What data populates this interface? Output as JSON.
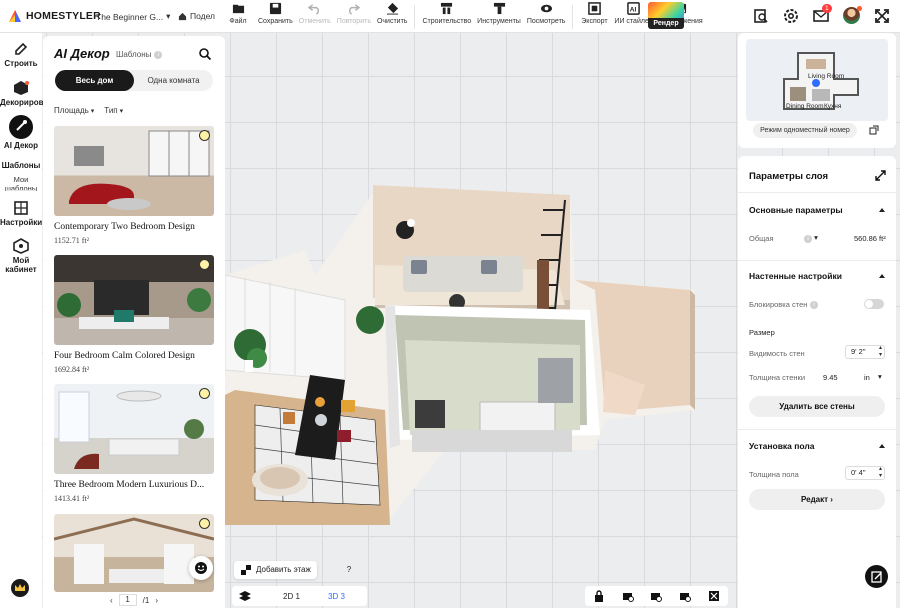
{
  "app": {
    "name": "HOMESTYLER",
    "project": "The Beginner G...",
    "house_crumb": "Подел"
  },
  "toolbar": {
    "items": [
      {
        "label": "Файл",
        "icon": "folder-icon",
        "enabled": true
      },
      {
        "label": "Сохранить",
        "icon": "save-icon",
        "enabled": true
      },
      {
        "label": "Отменить",
        "icon": "undo-icon",
        "enabled": false
      },
      {
        "label": "Повторить",
        "icon": "redo-icon",
        "enabled": false
      },
      {
        "label": "Очистить",
        "icon": "eraser-icon",
        "enabled": true
      },
      {
        "label": "Строительство",
        "icon": "build-icon",
        "enabled": true
      },
      {
        "label": "Инструменты",
        "icon": "tools-icon",
        "enabled": true
      },
      {
        "label": "Посмотреть",
        "icon": "eye-icon",
        "enabled": true
      },
      {
        "label": "Экспорт",
        "icon": "export-icon",
        "enabled": true
      },
      {
        "label": "ИИ стайлер",
        "icon": "ai-styler-icon",
        "enabled": true
      },
      {
        "label": "Изображения",
        "icon": "image-icon",
        "enabled": true
      }
    ],
    "render_label": "Рендер"
  },
  "header_right": {
    "notification_count": "1"
  },
  "leftnav": {
    "build": "Строить",
    "decorate": "Декорировать",
    "ai_decor": "AI Декор",
    "templates": "Шаблоны",
    "my_templates": "Мои шаблоны",
    "settings": "Настройки",
    "cabinet_line1": "Мой",
    "cabinet_line2": "кабинет"
  },
  "ai_panel": {
    "title": "AI Декор",
    "templates_label": "Шаблоны",
    "segments": {
      "whole_house": "Весь дом",
      "one_room": "Одна комната"
    },
    "filters": {
      "area": "Площадь",
      "type": "Тип"
    },
    "cards": [
      {
        "name": "Contemporary Two Bedroom Design",
        "area": "1152.71 ft²"
      },
      {
        "name": "Four Bedroom Calm Colored Design",
        "area": "1692.84 ft²"
      },
      {
        "name": "Three Bedroom Modern Luxurious D...",
        "area": "1413.41 ft²"
      },
      {
        "name": "",
        "area": ""
      }
    ],
    "pager": {
      "current": "1",
      "total": "/1"
    }
  },
  "bottom": {
    "add_floor": "Добавить этаж",
    "help": "?",
    "view_2d": "2D 1",
    "view_3d": "3D 3"
  },
  "minimap": {
    "labels": {
      "living": "Living Room",
      "dining": "Dining Room",
      "kitchen": "Кухня"
    },
    "mode_button": "Режим одноместный номер"
  },
  "layer_panel": {
    "title": "Параметры слоя",
    "basic_section": "Основные параметры",
    "general_label": "Общая",
    "general_value": "560.86 ft²",
    "wall_section": "Настенные настройки",
    "wall_lock_label": "Блокировка стен",
    "wall_lock_on": false,
    "size_label": "Размер",
    "wall_height_label": "Видимость стен",
    "wall_height_value": "9' 2\"",
    "wall_thickness_label": "Толщина стенки",
    "wall_thickness_value": "9.45",
    "wall_thickness_unit": "in",
    "delete_walls_button": "Удалить все стены",
    "floor_section": "Установка пола",
    "floor_thickness_label": "Толщина пола",
    "floor_thickness_value": "0' 4\"",
    "edit_button": "Редакт"
  },
  "colors": {
    "accent_blue": "#2f6cff",
    "dark": "#111111",
    "panel_bg": "#ffffff",
    "floor_wood": "#dcc4a6"
  }
}
